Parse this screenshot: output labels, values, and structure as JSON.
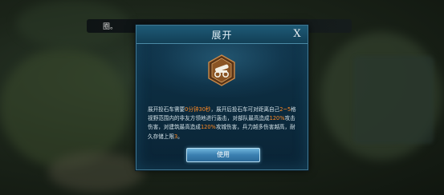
{
  "background": {
    "status_text": "圈。"
  },
  "dialog": {
    "title": "展开",
    "close_label": "X",
    "icon": "cannon-icon",
    "description": {
      "p1": "展开投石车需要",
      "time": "0分钟30秒",
      "p2": "，展开后投石车可对距离自己",
      "range": "2~5",
      "p3": "格视野范围内的非友方领地进行轰击，对部队最高造成",
      "troop_damage": "120%",
      "p4": "攻击伤害，对建筑最高造成",
      "building_damage": "120%",
      "p5": "攻城伤害，兵力越多伤害越高，耐久存储上限",
      "storage": "3",
      "p6": "。"
    },
    "use_button_label": "使用"
  },
  "colors": {
    "highlight": "#ff8a24",
    "dialog_bg": "#0c2b3e",
    "button": "#3a7fb0",
    "icon_frame": "#8a5424"
  }
}
